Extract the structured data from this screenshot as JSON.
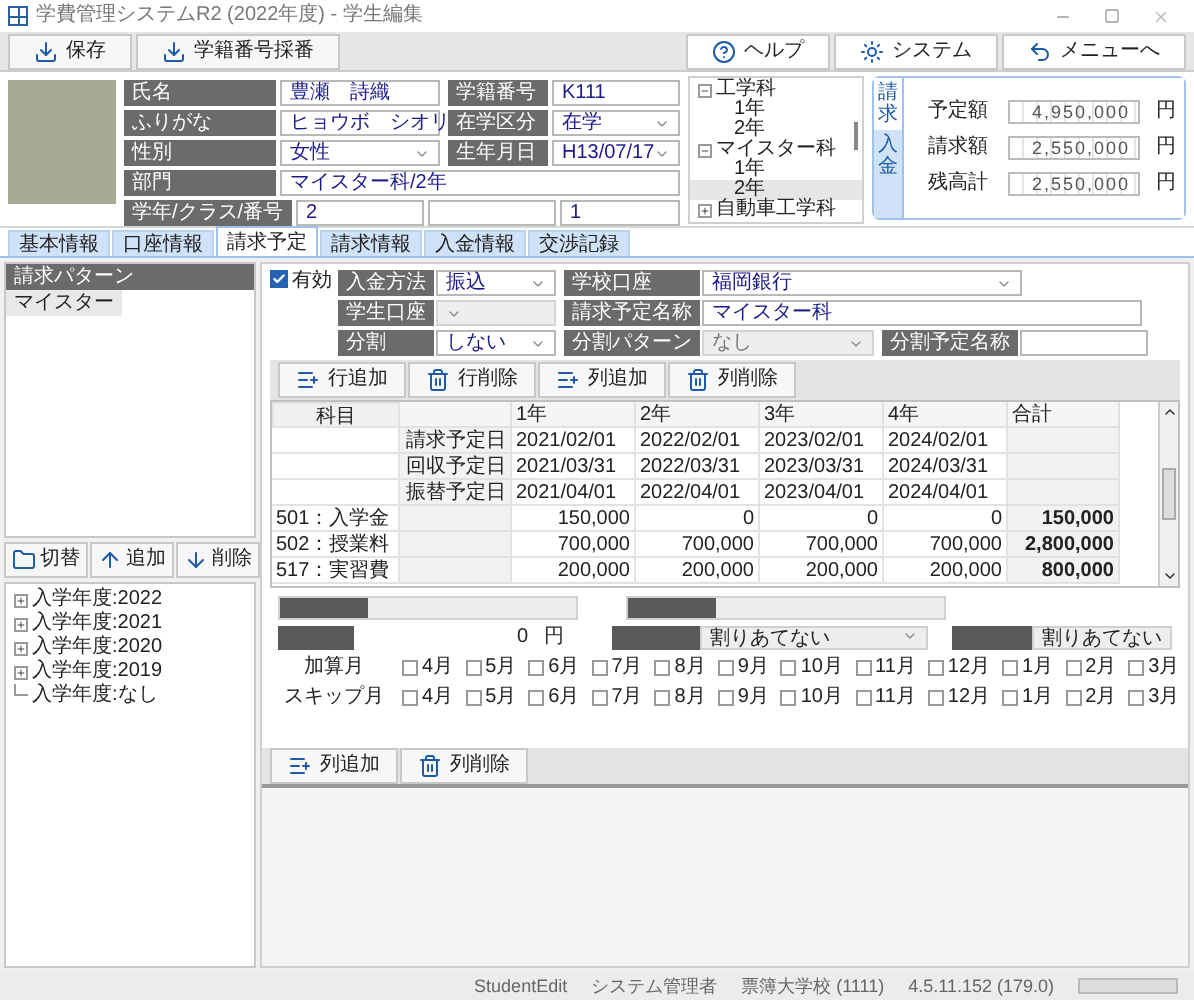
{
  "window": {
    "title": "学費管理システムR2 (2022年度) - 学生編集"
  },
  "toolbar": {
    "left": [
      {
        "label": "保存",
        "kind": "download"
      },
      {
        "label": "学籍番号採番",
        "kind": "download"
      }
    ],
    "right": [
      {
        "label": "ヘルプ",
        "kind": "help"
      },
      {
        "label": "システム",
        "kind": "system"
      },
      {
        "label": "メニューへ",
        "kind": "back"
      }
    ]
  },
  "student": {
    "rows": [
      [
        {
          "label": "氏名",
          "value": "豊瀬　詩織",
          "kind": "text"
        },
        {
          "label": "学籍番号",
          "value": "K111",
          "kind": "text"
        }
      ],
      [
        {
          "label": "ふりがな",
          "value": "ヒョウボ　シオリ",
          "kind": "text"
        },
        {
          "label": "在学区分",
          "value": "在学",
          "kind": "select"
        }
      ],
      [
        {
          "label": "性別",
          "value": "女性",
          "kind": "select"
        },
        {
          "label": "生年月日",
          "value": "H13/07/17",
          "kind": "select"
        }
      ],
      [
        {
          "label": "部門",
          "value": "マイスター科/2年",
          "kind": "readonly"
        }
      ]
    ],
    "grade_label": "学年/クラス/番号",
    "grade_values": [
      {
        "kind": "text",
        "value": "2"
      },
      {
        "kind": "text"
      },
      {
        "kind": "text",
        "value": "1"
      }
    ]
  },
  "department_tree": [
    {
      "label": "工学科",
      "expanded": true,
      "children": [
        {
          "label": "1年",
          "selected": false
        },
        {
          "label": "2年",
          "selected": false
        }
      ]
    },
    {
      "label": "マイスター科",
      "expanded": true,
      "children": [
        {
          "label": "1年",
          "selected": false
        },
        {
          "label": "2年",
          "selected": true
        }
      ]
    },
    {
      "label": "自動車工学科",
      "expanded": false
    }
  ],
  "amounts": {
    "side_tabs": [
      {
        "label": "請求",
        "selected": true
      },
      {
        "label": "入金",
        "selected": false
      }
    ],
    "rows": [
      {
        "label": "予定額",
        "value": "4,950,000",
        "unit": "円"
      },
      {
        "label": "請求額",
        "value": "2,550,000",
        "unit": "円"
      },
      {
        "label": "残高計",
        "value": "2,550,000",
        "unit": "円"
      }
    ]
  },
  "tabs": [
    {
      "label": "基本情報",
      "selected": false
    },
    {
      "label": "口座情報",
      "selected": false
    },
    {
      "label": "請求予定",
      "selected": true
    },
    {
      "label": "請求情報",
      "selected": false
    },
    {
      "label": "入金情報",
      "selected": false
    },
    {
      "label": "交渉記録",
      "selected": false
    }
  ],
  "sidebar": {
    "header": "請求パターン",
    "items": [
      {
        "label": "マイスター",
        "selected": true
      }
    ],
    "buttons": [
      {
        "label": "切替",
        "kind": "folder"
      },
      {
        "label": "追加",
        "kind": "up"
      },
      {
        "label": "削除",
        "kind": "down"
      }
    ],
    "tree": [
      {
        "label": "入学年度:2022",
        "expandable": true
      },
      {
        "label": "入学年度:2021",
        "expandable": true
      },
      {
        "label": "入学年度:2020",
        "expandable": true
      },
      {
        "label": "入学年度:2019",
        "expandable": true
      },
      {
        "label": "入学年度:なし",
        "expandable": false
      }
    ]
  },
  "pattern": {
    "enabled": {
      "label": "有効",
      "checked": true
    },
    "rows": [
      [
        {
          "label": "入金方法",
          "value": "振込",
          "kind": "select",
          "disabled": false
        },
        {
          "label": "学校口座",
          "value": "福岡銀行",
          "kind": "select",
          "disabled": false
        }
      ],
      [
        {
          "label": "学生口座",
          "kind": "select",
          "disabled": true
        },
        {
          "label": "請求予定名称",
          "value": "マイスター科",
          "kind": "text",
          "disabled": false
        }
      ],
      [
        {
          "label": "分割",
          "value": "しない",
          "kind": "select",
          "disabled": false
        },
        {
          "label": "分割パターン",
          "value": "なし",
          "kind": "select",
          "disabled": true
        },
        {
          "label": "分割予定名称",
          "kind": "text",
          "disabled": false
        }
      ]
    ]
  },
  "grid_toolbar": [
    {
      "label": "行追加",
      "kind": "add"
    },
    {
      "label": "行削除",
      "kind": "delete"
    },
    {
      "label": "列追加",
      "kind": "add"
    },
    {
      "label": "列削除",
      "kind": "delete"
    }
  ],
  "grid": {
    "columns": [
      "科目",
      "",
      "1年",
      "2年",
      "3年",
      "4年",
      "合計"
    ],
    "rows": [
      {
        "kind": "date",
        "subject": "",
        "label": "請求予定日",
        "cells": [
          "2021/02/01",
          "2022/02/01",
          "2023/02/01",
          "2024/02/01"
        ],
        "total": ""
      },
      {
        "kind": "date",
        "subject": "",
        "label": "回収予定日",
        "cells": [
          "2021/03/31",
          "2022/03/31",
          "2023/03/31",
          "2024/03/31"
        ],
        "total": ""
      },
      {
        "kind": "date",
        "subject": "",
        "label": "振替予定日",
        "cells": [
          "2021/04/01",
          "2022/04/01",
          "2023/04/01",
          "2024/04/01"
        ],
        "total": ""
      },
      {
        "kind": "amount",
        "subject": "501：入学金",
        "label": "",
        "cells": [
          "150,000",
          "0",
          "0",
          "0"
        ],
        "total": "150,000"
      },
      {
        "kind": "amount",
        "subject": "502：授業料",
        "label": "",
        "cells": [
          "700,000",
          "700,000",
          "700,000",
          "700,000"
        ],
        "total": "2,800,000"
      },
      {
        "kind": "amount",
        "subject": "517：実習費",
        "label": "",
        "cells": [
          "200,000",
          "200,000",
          "200,000",
          "200,000"
        ],
        "total": "800,000"
      }
    ]
  },
  "split": {
    "amount": "0",
    "unit": "円",
    "rounding": "割りあてない",
    "months_value": "割りあてない",
    "month_rows": [
      {
        "label": "加算月",
        "months": [
          {
            "label": "4月",
            "checked": false
          },
          {
            "label": "5月",
            "checked": false
          },
          {
            "label": "6月",
            "checked": false
          },
          {
            "label": "7月",
            "checked": false
          },
          {
            "label": "8月",
            "checked": false
          },
          {
            "label": "9月",
            "checked": false
          },
          {
            "label": "10月",
            "checked": false
          },
          {
            "label": "11月",
            "checked": false
          },
          {
            "label": "12月",
            "checked": false
          },
          {
            "label": "1月",
            "checked": false
          },
          {
            "label": "2月",
            "checked": false
          },
          {
            "label": "3月",
            "checked": false
          }
        ]
      },
      {
        "label": "スキップ月",
        "months": [
          {
            "label": "4月",
            "checked": false
          },
          {
            "label": "5月",
            "checked": false
          },
          {
            "label": "6月",
            "checked": false
          },
          {
            "label": "7月",
            "checked": false
          },
          {
            "label": "8月",
            "checked": false
          },
          {
            "label": "9月",
            "checked": false
          },
          {
            "label": "10月",
            "checked": false
          },
          {
            "label": "11月",
            "checked": false
          },
          {
            "label": "12月",
            "checked": false
          },
          {
            "label": "1月",
            "checked": false
          },
          {
            "label": "2月",
            "checked": false
          },
          {
            "label": "3月",
            "checked": false
          }
        ]
      }
    ]
  },
  "bottom_toolbar": [
    {
      "label": "列追加",
      "kind": "add"
    },
    {
      "label": "列削除",
      "kind": "delete"
    }
  ],
  "status_bar": [
    "StudentEdit",
    "システム管理者",
    "票簿大学校 (1111)",
    "4.5.11.152 (179.0)"
  ]
}
